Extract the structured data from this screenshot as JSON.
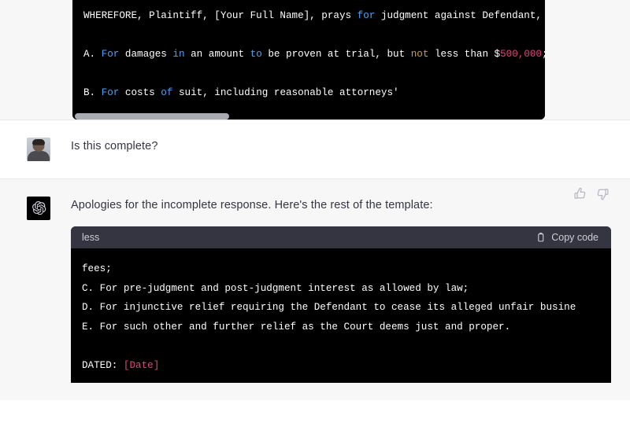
{
  "top_code_block": {
    "lines": [
      [
        {
          "t": "WHEREFORE, Plaintiff, [Your Full Name], prays ",
          "c": "txt"
        },
        {
          "t": "for",
          "c": "kw"
        },
        {
          "t": " judgment against Defendant, Pizza",
          "c": "txt"
        }
      ],
      [],
      [
        {
          "t": "A. ",
          "c": "txt"
        },
        {
          "t": "For",
          "c": "kw"
        },
        {
          "t": " damages ",
          "c": "txt"
        },
        {
          "t": "in",
          "c": "kw"
        },
        {
          "t": " an amount ",
          "c": "txt"
        },
        {
          "t": "to",
          "c": "kw"
        },
        {
          "t": " be proven at trial, but ",
          "c": "txt"
        },
        {
          "t": "not",
          "c": "warn"
        },
        {
          "t": " less than $",
          "c": "txt"
        },
        {
          "t": "500,000",
          "c": "num"
        },
        {
          "t": ";",
          "c": "txt"
        }
      ],
      [],
      [
        {
          "t": "B. ",
          "c": "txt"
        },
        {
          "t": "For",
          "c": "kw"
        },
        {
          "t": " costs ",
          "c": "txt"
        },
        {
          "t": "of",
          "c": "kw"
        },
        {
          "t": " suit, including reasonable attorneys'",
          "c": "txt"
        }
      ]
    ]
  },
  "user_message": {
    "avatar_name": "user-avatar",
    "text": "Is this complete?"
  },
  "assistant_message": {
    "avatar_name": "chatgpt-avatar",
    "text": "Apologies for the incomplete response. Here's the rest of the template:",
    "feedback": {
      "thumbs_up_label": "thumb-up-icon",
      "thumbs_down_label": "thumb-down-icon"
    },
    "code_block": {
      "language": "less",
      "copy_label": "Copy code",
      "copy_icon": "clipboard-icon",
      "lines": [
        [
          {
            "t": "fees;",
            "c": "txt"
          }
        ],
        [
          {
            "t": "C. For pre-judgment and post-judgment interest as allowed by law;",
            "c": "txt"
          }
        ],
        [
          {
            "t": "D. For injunctive relief requiring the Defendant to cease its alleged unfair busine",
            "c": "txt"
          }
        ],
        [
          {
            "t": "E. For such other and further relief as the Court deems just and proper.",
            "c": "txt"
          }
        ],
        [],
        [
          {
            "t": "DATED: ",
            "c": "txt"
          },
          {
            "t": "[Date]",
            "c": "str"
          }
        ]
      ]
    }
  },
  "colors": {
    "page_background": "#ffffff",
    "assistant_row_background": "#f7f7f8",
    "code_background": "#000000",
    "code_header_background": "#343541",
    "text": "#343541",
    "keyword": "#4ea1f3",
    "warning": "#d19a3e",
    "number": "#e0467a",
    "string": "#e0467a",
    "scrollbar_thumb": "#a9abb3"
  }
}
